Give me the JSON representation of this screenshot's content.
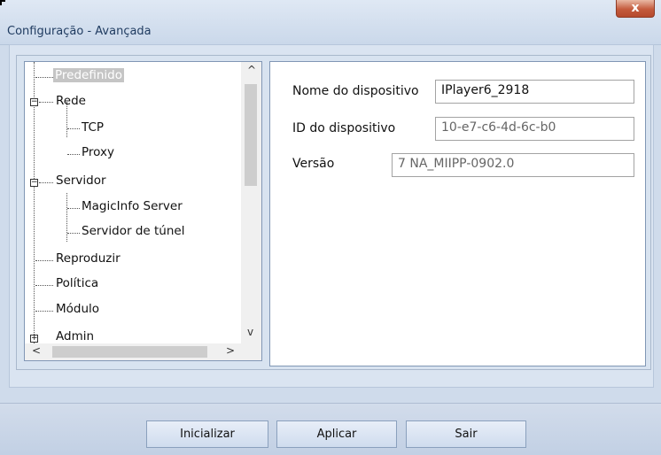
{
  "window": {
    "title": "Configuração - Avançada",
    "close_label": "x"
  },
  "tree": {
    "items": [
      {
        "label": "Predefinido",
        "selected": true
      },
      {
        "label": "Rede",
        "expander": "−"
      },
      {
        "label": "TCP"
      },
      {
        "label": "Proxy"
      },
      {
        "label": "Servidor",
        "expander": "−"
      },
      {
        "label": "MagicInfo Server"
      },
      {
        "label": "Servidor de túnel"
      },
      {
        "label": "Reproduzir"
      },
      {
        "label": "Política"
      },
      {
        "label": "Módulo"
      },
      {
        "label": "Admin",
        "expander": "+"
      }
    ],
    "scroll_up": "^",
    "scroll_down": "v",
    "scroll_left": "<",
    "scroll_right": ">"
  },
  "settings": {
    "device_name_label": "Nome do dispositivo",
    "device_name_value": "IPlayer6_2918",
    "device_id_label": "ID do dispositivo",
    "device_id_value": "10-e7-c6-4d-6c-b0",
    "version_label": "Versão",
    "version_value": "7 NA_MIIPP-0902.0"
  },
  "footer": {
    "init_label": "Inicializar",
    "apply_label": "Aplicar",
    "exit_label": "Sair"
  }
}
